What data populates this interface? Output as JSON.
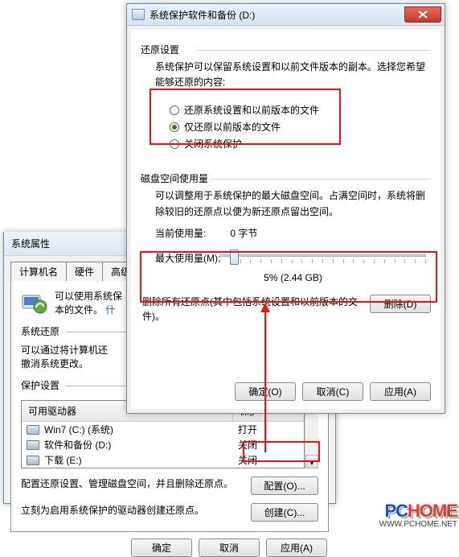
{
  "back": {
    "title": "系统属性",
    "tabs": [
      "计算机名",
      "硬件",
      "高级"
    ],
    "intro_line1": "可以使用系统保",
    "intro_line2": "本的文件。",
    "intro_link": "什",
    "group_restore": "系统还原",
    "restore_desc": "可以通过将计算机还\n撤消系统更改。",
    "group_protect": "保护设置",
    "col_drive": "可用驱动器",
    "col_protect": "保护",
    "drives": [
      {
        "name": "Win7 (C:) (系统)",
        "protect": "打开"
      },
      {
        "name": "软件和备份 (D:)",
        "protect": "关闭"
      },
      {
        "name": "下载 (E:)",
        "protect": "关闭"
      }
    ],
    "config_desc": "配置还原设置、管理磁盘空间，并且删除还原点。",
    "config_btn": "配置(O)...",
    "create_desc": "立刻为启用系统保护的驱动器创建还原点。",
    "create_btn": "创建(C)...",
    "ok": "确定",
    "cancel": "取消",
    "apply": "应用(A)"
  },
  "front": {
    "title": "系统保护软件和备份 (D:)",
    "sect_restore": "还原设置",
    "restore_desc": "系统保护可以保留系统设置和以前文件版本的副本。选择您希望能够还原的内容:",
    "radios": [
      "还原系统设置和以前版本的文件",
      "仅还原以前版本的文件",
      "关闭系统保护"
    ],
    "radio_selected": 1,
    "sect_disk": "磁盘空间使用量",
    "disk_desc": "可以调整用于系统保护的最大磁盘空间。占满空间时，系统将删除较旧的还原点以便为新还原点留出空间。",
    "cur_label": "当前使用量:",
    "cur_value": "0 字节",
    "max_label": "最大使用量(M):",
    "slider_percent": 5,
    "slider_display": "5% (2.44 GB)",
    "delete_desc": "删除所有还原点(其中包括系统设置和以前版本的文件)。",
    "delete_btn": "删除(D)",
    "ok": "确定(O)",
    "cancel": "取消(C)",
    "apply": "应用(A)"
  },
  "watermark": {
    "brand1": "PC",
    "brand2": "HOME",
    "url": "WWW.PCHOME.NET"
  }
}
